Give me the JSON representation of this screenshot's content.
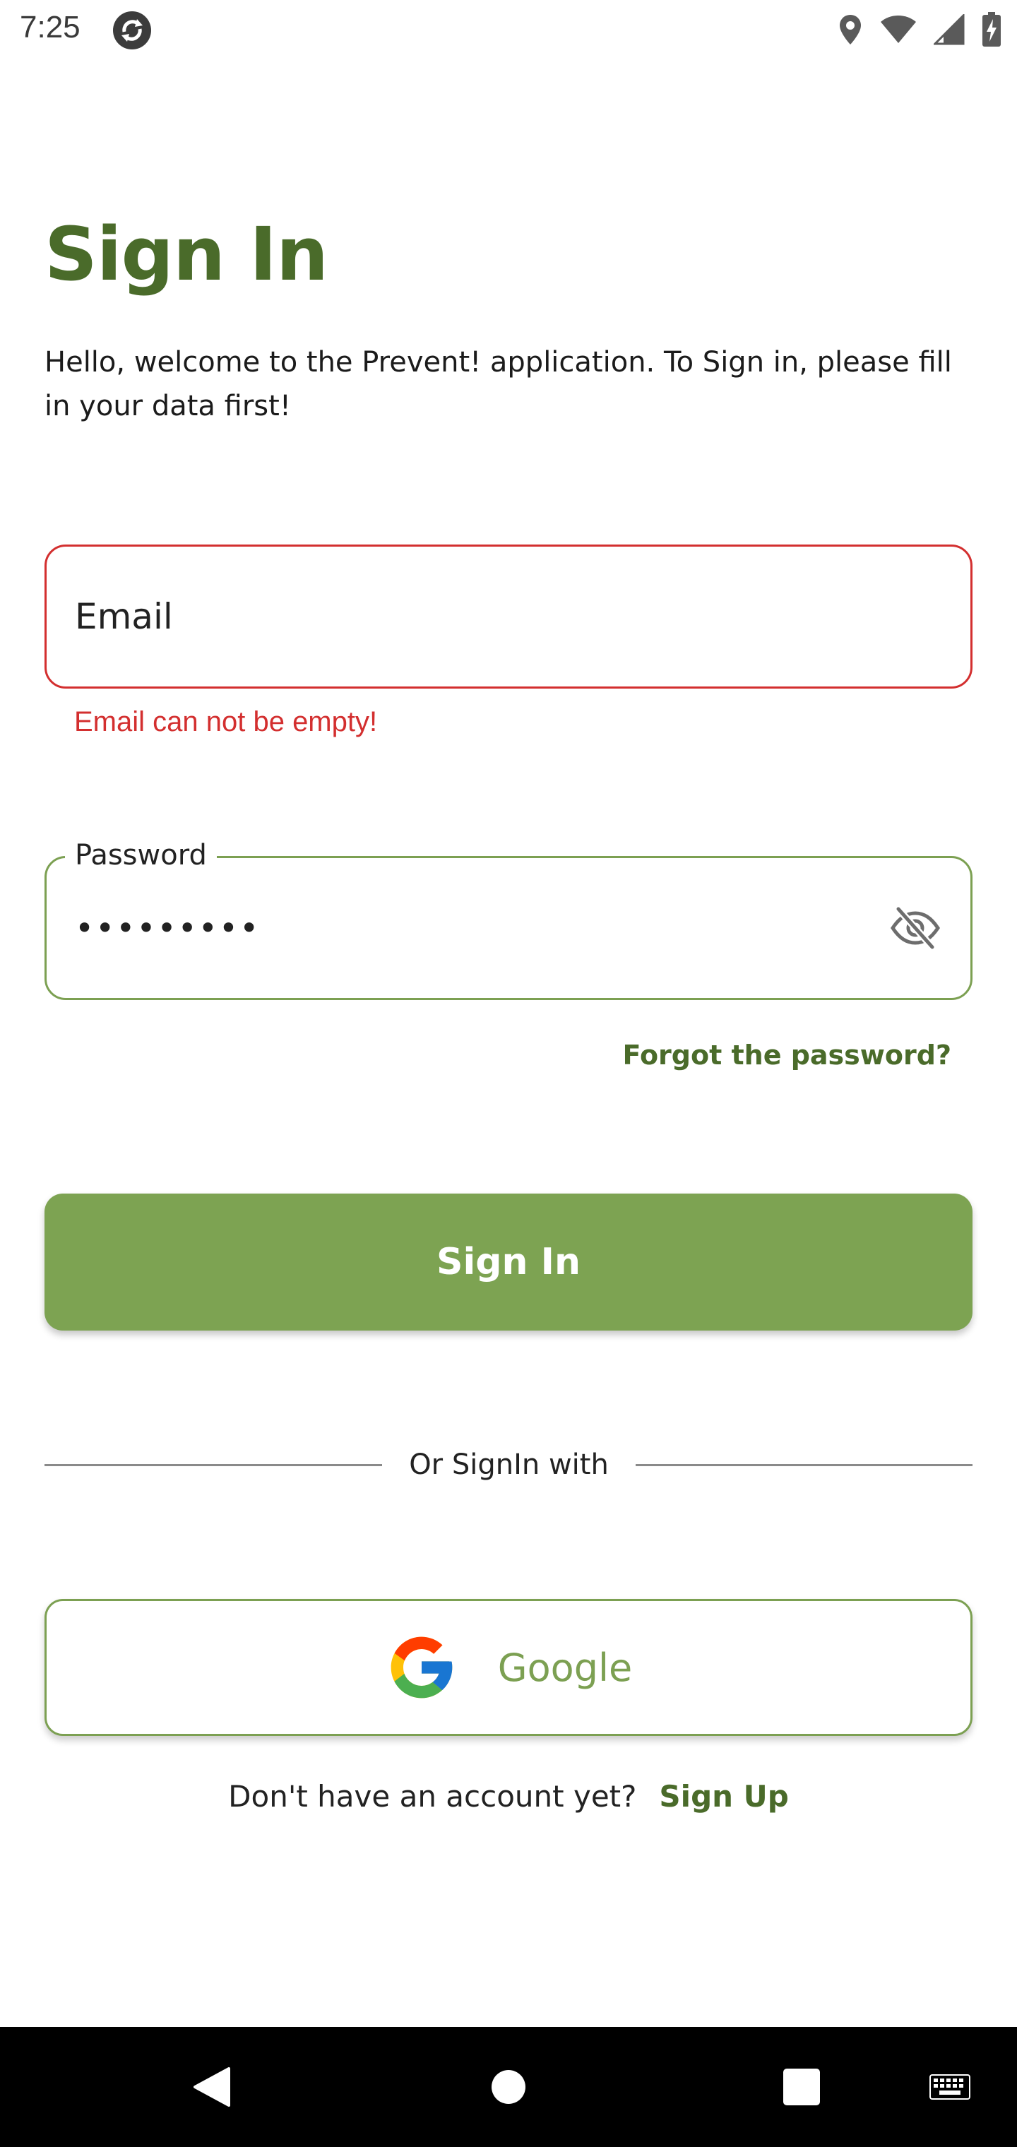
{
  "status_bar": {
    "time": "7:25",
    "app_icon": "sync-app-icon",
    "icons": [
      "location-icon",
      "wifi-icon",
      "cellular-signal-icon",
      "battery-charging-icon"
    ]
  },
  "sign_in": {
    "title": "Sign In",
    "subtitle": "Hello, welcome to the Prevent! application. To Sign in, please fill in your data first!"
  },
  "email_field": {
    "placeholder": "Email",
    "value": "",
    "error": "Email can not be empty!"
  },
  "password_field": {
    "label": "Password",
    "value": "•••••••••",
    "toggle_icon": "visibility-off-icon"
  },
  "forgot_password": "Forgot the password?",
  "sign_in_button": "Sign In",
  "divider_text": "Or SignIn with",
  "google_button": {
    "label": "Google",
    "icon": "google-logo-icon"
  },
  "sign_up": {
    "prompt": "Don't have an account yet?",
    "link": "Sign Up"
  },
  "nav_bar": {
    "buttons": [
      "back-icon",
      "home-icon",
      "recents-icon",
      "keyboard-icon"
    ]
  },
  "colors": {
    "primary_dark": "#4a6b2a",
    "primary": "#7da352",
    "error": "#d32f2f",
    "text": "#222222"
  }
}
